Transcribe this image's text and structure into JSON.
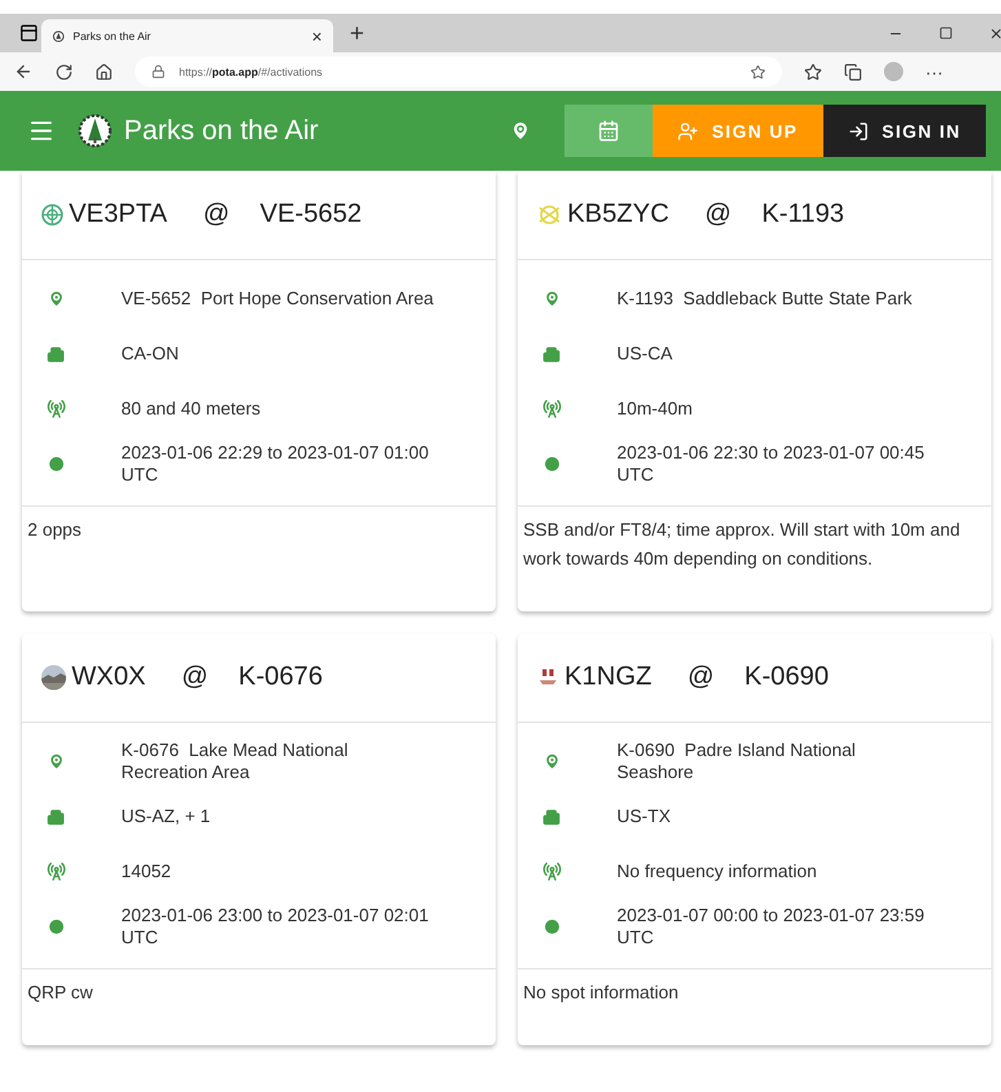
{
  "browser": {
    "tab": {
      "title": "Parks on the Air",
      "close": "×"
    },
    "new_tab": "+",
    "url": "https://**pota.app**/#/activations",
    "more": "···"
  },
  "app_bar": {
    "title": "Parks on the Air",
    "views": [
      {
        "kind": "map",
        "selected": false
      },
      {
        "kind": "calendar",
        "selected": true
      }
    ],
    "buttons": [
      {
        "kind": "signup",
        "label": "SIGN UP"
      },
      {
        "kind": "signin",
        "label": "SIGN IN"
      }
    ]
  },
  "activations": [
    {
      "kind": "globe",
      "callsign": "VE3PTA",
      "at": "@",
      "reference": "VE-5652",
      "details": [
        {
          "kind": "park",
          "text": "VE-5652  Port Hope Conservation Area"
        },
        {
          "kind": "location",
          "text": "CA-ON"
        },
        {
          "kind": "frequency",
          "text": "80 and 40 meters"
        },
        {
          "kind": "time",
          "text": "2023-01-06 22:29 to 2023-01-07 01:00 UTC"
        }
      ],
      "comments": "2 opps"
    },
    {
      "kind": "emblem",
      "callsign": "KB5ZYC",
      "at": "@",
      "reference": "K-1193",
      "details": [
        {
          "kind": "park",
          "text": "K-1193  Saddleback Butte State Park"
        },
        {
          "kind": "location",
          "text": "US-CA"
        },
        {
          "kind": "frequency",
          "text": "10m-40m"
        },
        {
          "kind": "time",
          "text": "2023-01-06 22:30 to 2023-01-07 00:45 UTC"
        }
      ],
      "comments": "SSB and/or FT8/4; time approx. Will start with 10m and work towards 40m depending on conditions."
    },
    {
      "callsign": "WX0X",
      "at": "@",
      "reference": "K-0676",
      "details": [
        {
          "kind": "park",
          "text": "K-0676  Lake Mead National Recreation Area"
        },
        {
          "kind": "location",
          "text": "US-AZ, + 1"
        },
        {
          "kind": "frequency",
          "text": "14052"
        },
        {
          "kind": "time",
          "text": "2023-01-06 23:00 to 2023-01-07 02:01 UTC"
        }
      ],
      "comments": "QRP cw"
    },
    {
      "kind": "bell",
      "callsign": "K1NGZ",
      "at": "@",
      "reference": "K-0690",
      "details": [
        {
          "kind": "park",
          "text": "K-0690  Padre Island National Seashore"
        },
        {
          "kind": "location",
          "text": "US-TX"
        },
        {
          "kind": "frequency",
          "text": "No frequency information"
        },
        {
          "kind": "time",
          "text": "2023-01-07 00:00 to 2023-01-07 23:59 UTC"
        }
      ],
      "comments": "No spot information"
    }
  ]
}
